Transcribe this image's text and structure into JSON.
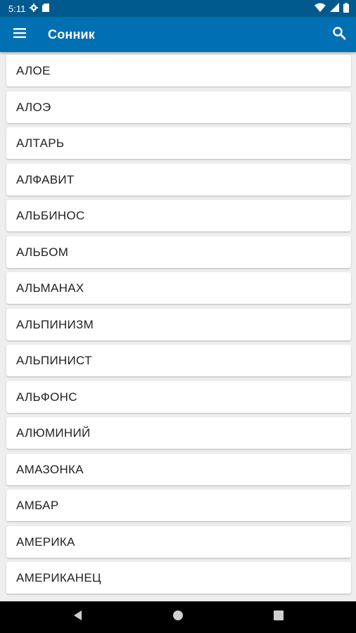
{
  "status_bar": {
    "time": "5:11",
    "left_icons": [
      "settings-icon",
      "sd-card-icon"
    ],
    "right_icons": [
      "wifi-icon",
      "signal-icon",
      "battery-icon"
    ]
  },
  "app_bar": {
    "title": "Сонник",
    "menu_icon": "hamburger-menu-icon",
    "search_icon": "search-icon",
    "background_color": "#0070b3",
    "status_color": "#005a8e"
  },
  "list": {
    "items": [
      "АЛОЕ",
      "АЛОЭ",
      "АЛТАРЬ",
      "АЛФАВИТ",
      "АЛЬБИНОС",
      "АЛЬБОМ",
      "АЛЬМАНАХ",
      "АЛЬПИНИЗМ",
      "АЛЬПИНИСТ",
      "АЛЬФОНС",
      "АЛЮМИНИЙ",
      "АМАЗОНКА",
      "АМБАР",
      "АМЕРИКА",
      "АМЕРИКАНЕЦ"
    ]
  },
  "nav_bar": {
    "icons": [
      "back-icon",
      "home-icon",
      "recents-icon"
    ]
  }
}
